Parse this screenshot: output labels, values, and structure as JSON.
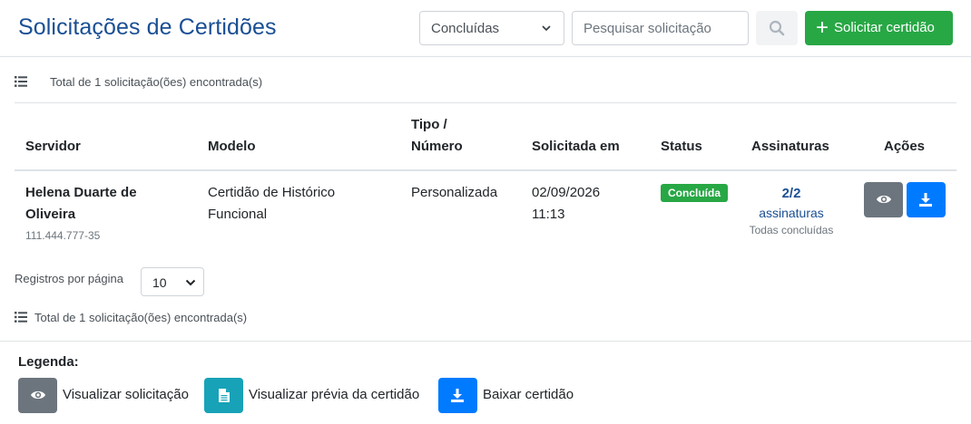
{
  "header": {
    "title": "Solicitações de Certidões",
    "status_filter": "Concluídas",
    "search_placeholder": "Pesquisar solicitação",
    "add_button_label": "Solicitar certidão",
    "add_button_icon": "plus-icon",
    "search_button_icon": "search-icon"
  },
  "summary": {
    "top_count": "Total de 1 solicitação(ões) encontrada(s)",
    "bottom_count": "Total de 1 solicitação(ões) encontrada(s)"
  },
  "table": {
    "columns": {
      "servidor": "Servidor",
      "modelo": "Modelo",
      "tipo_line1": "Tipo /",
      "tipo_line2": "Número",
      "solicitada": "Solicitada em",
      "status": "Status",
      "assinaturas": "Assinaturas",
      "acoes": "Ações"
    },
    "rows": [
      {
        "name_line1": "Helena Duarte de",
        "name_line2": "Oliveira",
        "cpf": "111.444.777-35",
        "modelo_line1": "Certidão de Histórico",
        "modelo_line2": "Funcional",
        "tipo": "Personalizada",
        "date": "02/09/2026",
        "time": "11:13",
        "status": "Concluída",
        "signatures_count": "2/2",
        "signatures_word": "assinaturas",
        "signatures_sub": "Todas concluídas",
        "view_icon": "eye-icon",
        "download_icon": "download-icon"
      }
    ]
  },
  "pagination": {
    "per_page_label": "Registros por página",
    "per_page_value": "10"
  },
  "legend": {
    "title": "Legenda:",
    "items": [
      {
        "icon": "eye-icon",
        "label": "Visualizar solicitação",
        "color": "#6c757d"
      },
      {
        "icon": "document-icon",
        "label": "Visualizar prévia da certidão",
        "color": "#17a2b8"
      },
      {
        "icon": "download-icon",
        "label": "Baixar certidão",
        "color": "#007bff"
      }
    ]
  },
  "colors": {
    "title": "#1a4f94",
    "success": "#28a745",
    "primary": "#007bff",
    "secondary": "#6c757d",
    "info": "#17a2b8"
  }
}
